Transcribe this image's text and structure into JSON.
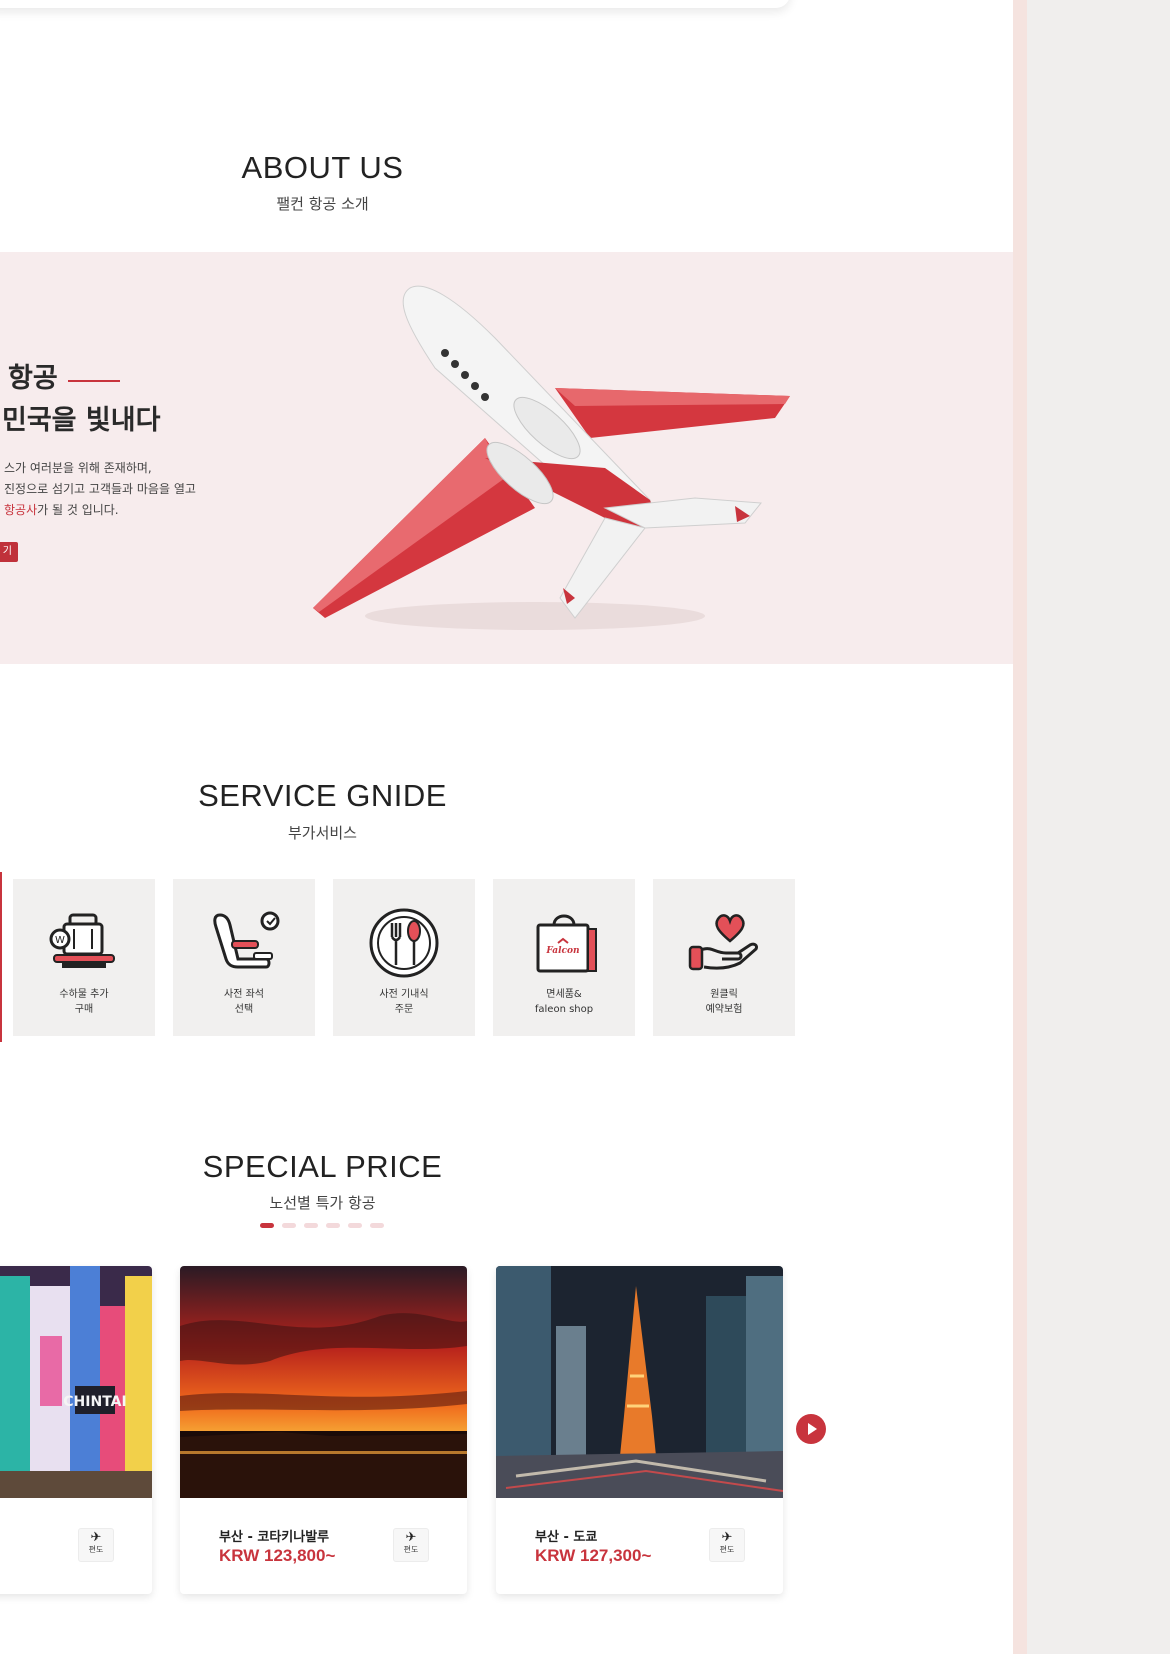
{
  "about": {
    "title": "ABOUT US",
    "subtitle": "팰컨 항공 소개",
    "heading_line1": "항공",
    "heading_line2": "민국을 빛내다",
    "desc_line1": "스가 여러분을 위해 존재하며,",
    "desc_line2": "진정으로 섬기고 고객들과 마음을 열고",
    "desc_line3_highlight": "항공사",
    "desc_line3_rest": "가 될 것 입니다.",
    "button_label": "기"
  },
  "service": {
    "title": "SERVICE GNIDE",
    "subtitle": "부가서비스",
    "items": [
      {
        "label1": "수하물 추가",
        "label2": "구매",
        "icon": "baggage-icon"
      },
      {
        "label1": "사전 좌석",
        "label2": "선택",
        "icon": "seat-icon"
      },
      {
        "label1": "사전 기내식",
        "label2": "주문",
        "icon": "meal-icon"
      },
      {
        "label1": "면세품&",
        "label2": "faleon shop",
        "icon": "shopping-bag-icon"
      },
      {
        "label1": "원클릭",
        "label2": "예약보험",
        "icon": "heart-hand-icon"
      }
    ]
  },
  "special": {
    "title": "SPECIAL PRICE",
    "subtitle": "노선별 특가 항공",
    "page_count": 6,
    "active_page": 1,
    "cards": [
      {
        "route": "",
        "price": "~",
        "image": "osaka-signs-photo"
      },
      {
        "route": "부산 - 코타키나발루",
        "price": "KRW 123,800~",
        "image": "sunset-sea-photo"
      },
      {
        "route": "부산 - 도쿄",
        "price": "KRW 127,300~",
        "image": "tokyo-tower-photo"
      }
    ],
    "mini_label": "편도",
    "mini_icon": "✈"
  },
  "colors": {
    "accent": "#c8343d",
    "band": "#f7eced",
    "card": "#f1f0ef"
  }
}
